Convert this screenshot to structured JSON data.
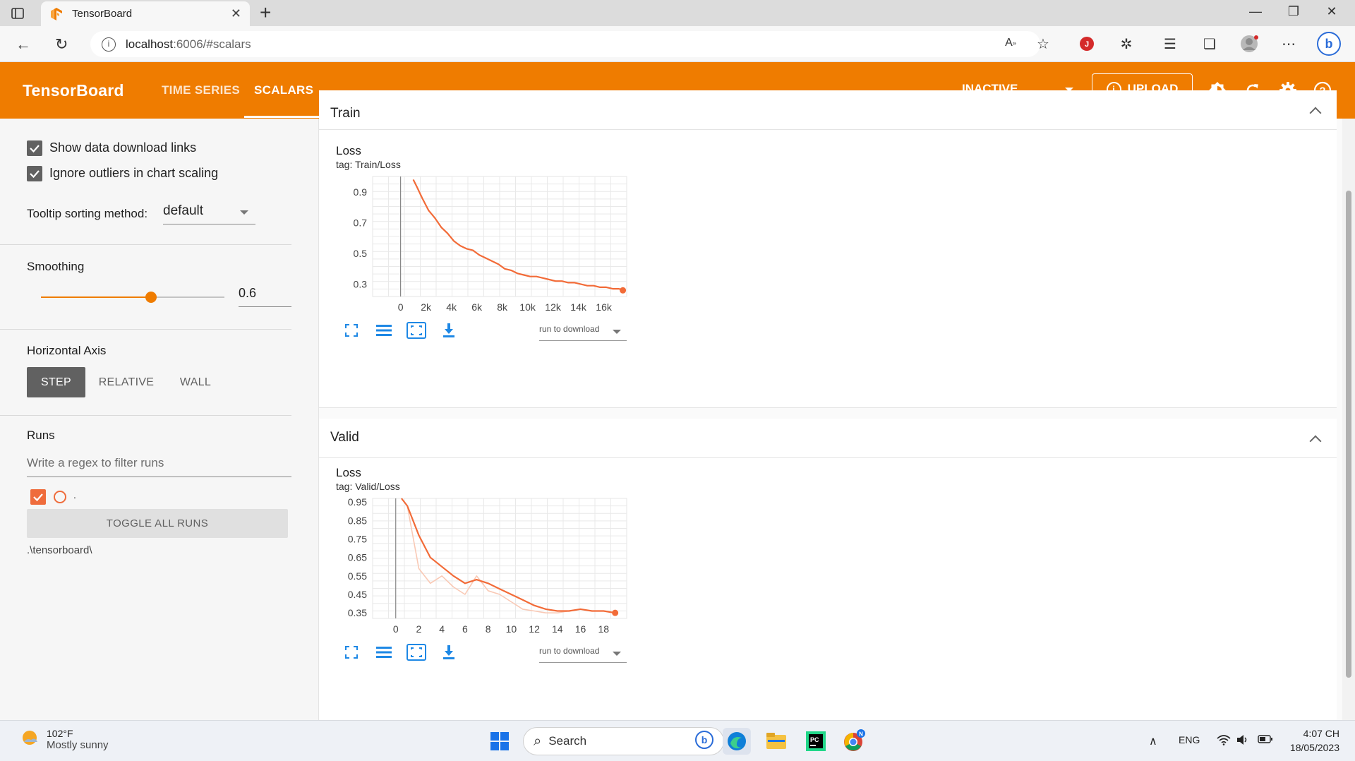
{
  "browser": {
    "tab_title": "TensorBoard",
    "url_host": "localhost",
    "url_path": ":6006/#scalars"
  },
  "header": {
    "brand": "TensorBoard",
    "tabs": [
      {
        "label": "TIME SERIES",
        "active": false
      },
      {
        "label": "SCALARS",
        "active": true
      }
    ],
    "run_status": "INACTIVE",
    "upload_label": "UPLOAD"
  },
  "sidebar": {
    "show_download_links": {
      "label": "Show data download links",
      "checked": true
    },
    "ignore_outliers": {
      "label": "Ignore outliers in chart scaling",
      "checked": true
    },
    "tooltip_sorting": {
      "label": "Tooltip sorting method:",
      "value": "default"
    },
    "smoothing": {
      "label": "Smoothing",
      "value": "0.6",
      "level": 0.6
    },
    "horizontal_axis": {
      "label": "Horizontal Axis",
      "options": [
        "STEP",
        "RELATIVE",
        "WALL"
      ],
      "selected": "STEP"
    },
    "runs": {
      "label": "Runs",
      "filter_placeholder": "Write a regex to filter runs",
      "run_name": ".",
      "toggle_all_label": "TOGGLE ALL RUNS",
      "logdir": ".\\tensorboard\\"
    }
  },
  "main": {
    "panes": [
      {
        "name": "Train",
        "card": {
          "title": "Loss",
          "tag": "tag: Train/Loss",
          "download_select": "run to download"
        }
      },
      {
        "name": "Valid",
        "card": {
          "title": "Loss",
          "tag": "tag: Valid/Loss",
          "download_select": "run to download"
        }
      }
    ]
  },
  "chart_data": [
    {
      "type": "line",
      "title": "Loss",
      "subtitle": "tag: Train/Loss",
      "xlim": [
        -2200,
        17800
      ],
      "ylim": [
        0.22,
        1.0
      ],
      "x_ticks": [
        0,
        2000,
        4000,
        6000,
        8000,
        10000,
        12000,
        14000,
        16000
      ],
      "x_tick_labels": [
        "0",
        "2k",
        "4k",
        "6k",
        "8k",
        "10k",
        "12k",
        "14k",
        "16k"
      ],
      "y_ticks": [
        0.3,
        0.5,
        0.7,
        0.9
      ],
      "y_tick_labels": [
        "0.3",
        "0.5",
        "0.7",
        "0.9"
      ],
      "grid": true,
      "series": [
        {
          "color": "#f26b38",
          "x": [
            1000,
            1300,
            1700,
            2200,
            2700,
            3200,
            3700,
            4200,
            4700,
            5200,
            5700,
            6200,
            6700,
            7200,
            7700,
            8200,
            8700,
            9200,
            9700,
            10200,
            10700,
            11200,
            11700,
            12200,
            12700,
            13200,
            13700,
            14200,
            14700,
            15200,
            15700,
            16200,
            16700,
            17200,
            17500
          ],
          "y": [
            0.98,
            0.93,
            0.86,
            0.78,
            0.73,
            0.67,
            0.63,
            0.58,
            0.55,
            0.53,
            0.52,
            0.49,
            0.47,
            0.45,
            0.43,
            0.4,
            0.39,
            0.37,
            0.36,
            0.35,
            0.35,
            0.34,
            0.33,
            0.32,
            0.32,
            0.31,
            0.31,
            0.3,
            0.29,
            0.29,
            0.28,
            0.28,
            0.27,
            0.27,
            0.26
          ]
        }
      ]
    },
    {
      "type": "line",
      "title": "Loss",
      "subtitle": "tag: Valid/Loss",
      "xlim": [
        -2,
        20
      ],
      "ylim": [
        0.32,
        0.97
      ],
      "x_ticks": [
        0,
        2,
        4,
        6,
        8,
        10,
        12,
        14,
        16,
        18
      ],
      "x_tick_labels": [
        "0",
        "2",
        "4",
        "6",
        "8",
        "10",
        "12",
        "14",
        "16",
        "18"
      ],
      "y_ticks": [
        0.35,
        0.45,
        0.55,
        0.65,
        0.75,
        0.85,
        0.95
      ],
      "y_tick_labels": [
        "0.35",
        "0.45",
        "0.55",
        "0.65",
        "0.75",
        "0.85",
        "0.95"
      ],
      "grid": true,
      "series": [
        {
          "name": "smoothed",
          "color": "#f26b38",
          "x": [
            0.5,
            1,
            2,
            3,
            4,
            5,
            6,
            7,
            8,
            9,
            10,
            11,
            12,
            13,
            14,
            15,
            16,
            17,
            18,
            19
          ],
          "y": [
            0.97,
            0.93,
            0.77,
            0.65,
            0.6,
            0.55,
            0.51,
            0.53,
            0.51,
            0.48,
            0.45,
            0.42,
            0.39,
            0.37,
            0.36,
            0.36,
            0.37,
            0.36,
            0.36,
            0.35
          ]
        },
        {
          "name": "raw",
          "color": "#f9c9b5",
          "x": [
            1,
            2,
            3,
            4,
            5,
            6,
            7,
            8,
            9,
            10,
            11,
            12,
            13,
            14,
            15,
            16,
            17,
            18,
            19
          ],
          "y": [
            0.93,
            0.59,
            0.51,
            0.55,
            0.49,
            0.45,
            0.55,
            0.47,
            0.45,
            0.41,
            0.37,
            0.36,
            0.35,
            0.35,
            0.36,
            0.37,
            0.36,
            0.36,
            0.35
          ]
        }
      ]
    }
  ],
  "taskbar": {
    "weather_temp": "102°F",
    "weather_desc": "Mostly sunny",
    "search_label": "Search",
    "lang": "ENG",
    "time": "4:07 CH",
    "date": "18/05/2023"
  }
}
